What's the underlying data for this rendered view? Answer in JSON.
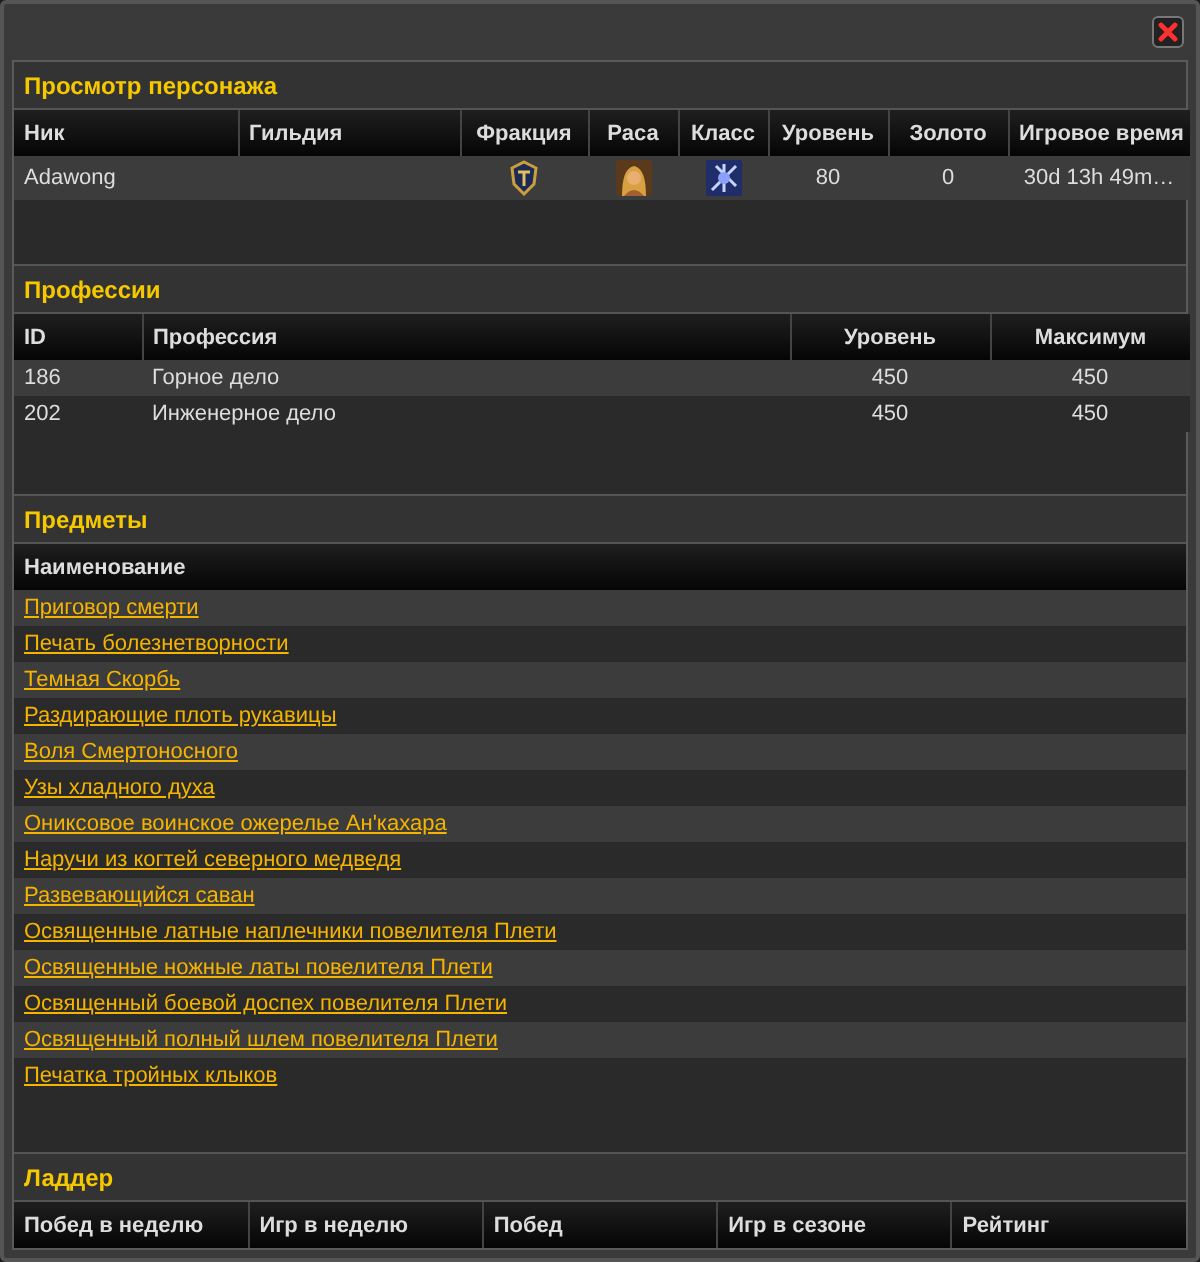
{
  "character": {
    "title": "Просмотр персонажа",
    "columns": [
      "Ник",
      "Гильдия",
      "Фракция",
      "Раса",
      "Класс",
      "Уровень",
      "Золото",
      "Игровое время"
    ],
    "rows": [
      {
        "cells": [
          {
            "kind": "text",
            "text": "Adawong"
          },
          {
            "kind": "text",
            "text": ""
          },
          {
            "kind": "faction"
          },
          {
            "kind": "race"
          },
          {
            "kind": "class"
          },
          {
            "kind": "text",
            "text": "80"
          },
          {
            "kind": "text",
            "text": "0"
          },
          {
            "kind": "text",
            "text": "30d 13h 49m…"
          }
        ]
      }
    ]
  },
  "professions": {
    "title": "Профессии",
    "columns": [
      "ID",
      "Профессия",
      "Уровень",
      "Максимум"
    ],
    "rows": [
      {
        "cells": [
          "186",
          "Горное дело",
          "450",
          "450"
        ]
      },
      {
        "cells": [
          "202",
          "Инженерное дело",
          "450",
          "450"
        ]
      }
    ]
  },
  "items": {
    "title": "Предметы",
    "columns": [
      "Наименование"
    ],
    "rows": [
      "Приговор смерти",
      "Печать болезнетворности",
      "Темная Скорбь",
      "Раздирающие плоть рукавицы",
      "Воля Смертоносного",
      "Узы хладного духа",
      "Ониксовое воинское ожерелье Ан'кахара",
      "Наручи из когтей северного медведя",
      "Развевающийся саван",
      "Освященные латные наплечники повелителя Плети",
      "Освященные ножные латы повелителя Плети",
      "Освященный боевой доспех повелителя Плети",
      "Освященный полный шлем повелителя Плети",
      "Печатка тройных клыков"
    ]
  },
  "ladder": {
    "title": "Ладдер",
    "columns": [
      "Побед в неделю",
      "Игр в неделю",
      "Побед",
      "Игр в сезоне",
      "Рейтинг"
    ]
  }
}
